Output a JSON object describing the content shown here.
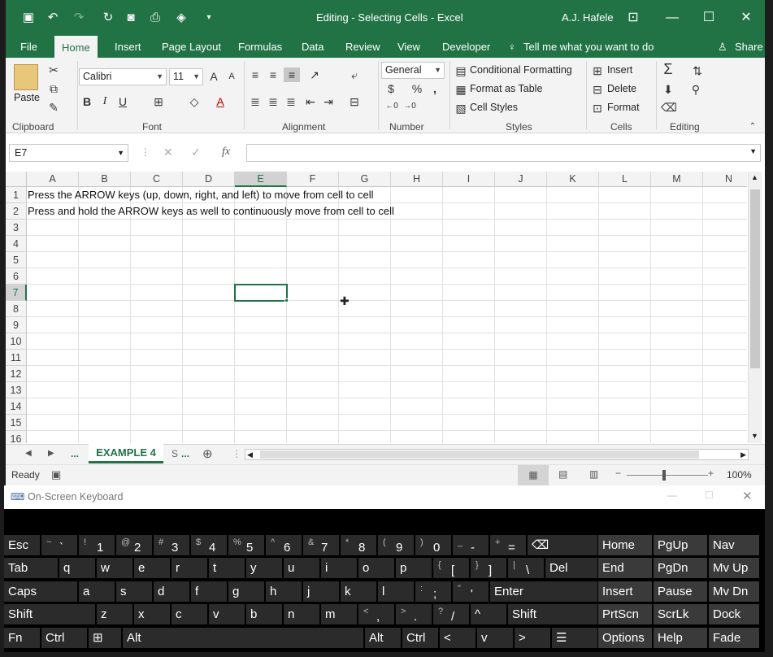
{
  "window": {
    "title": "Editing - Selecting Cells  -  Excel",
    "user": "A.J. Hafele"
  },
  "ribbon_tabs": [
    "File",
    "Home",
    "Insert",
    "Page Layout",
    "Formulas",
    "Data",
    "Review",
    "View",
    "Developer"
  ],
  "tell_me": "Tell me what you want to do",
  "share": "Share",
  "clipboard": {
    "paste": "Paste",
    "label": "Clipboard"
  },
  "font": {
    "name": "Calibri",
    "size": "11",
    "label": "Font",
    "bold": "B",
    "italic": "I",
    "underline": "U"
  },
  "alignment": {
    "label": "Alignment"
  },
  "number": {
    "format": "General",
    "label": "Number",
    "currency": "$",
    "percent": "%",
    "comma": ","
  },
  "styles": {
    "conditional": "Conditional Formatting",
    "table": "Format as Table",
    "cell": "Cell Styles",
    "label": "Styles"
  },
  "cells": {
    "insert": "Insert",
    "delete": "Delete",
    "format": "Format",
    "label": "Cells"
  },
  "editing": {
    "label": "Editing"
  },
  "formula_bar": {
    "name_box": "E7",
    "fx": "fx",
    "value": ""
  },
  "columns": [
    "A",
    "B",
    "C",
    "D",
    "E",
    "F",
    "G",
    "H",
    "I",
    "J",
    "K",
    "L",
    "M",
    "N"
  ],
  "rows": [
    "1",
    "2",
    "3",
    "4",
    "5",
    "6",
    "7",
    "8",
    "9",
    "10",
    "11",
    "12",
    "13",
    "14",
    "15",
    "16"
  ],
  "cells_data": {
    "a1": "Press the ARROW keys (up, down, right, and left) to move from cell to cell",
    "a2": "Press and hold the ARROW keys as well to continuously move from cell to cell"
  },
  "sheets": {
    "more_left": "...",
    "active": "EXAMPLE 4",
    "more_right": "...",
    "partial": "S"
  },
  "status": {
    "mode": "Ready",
    "zoom": "100%"
  },
  "osk": {
    "title": "On-Screen Keyboard",
    "rows": [
      [
        {
          "m": "Esc"
        },
        {
          "s": "~",
          "m": "`"
        },
        {
          "s": "!",
          "m": "1"
        },
        {
          "s": "@",
          "m": "2"
        },
        {
          "s": "#",
          "m": "3"
        },
        {
          "s": "$",
          "m": "4"
        },
        {
          "s": "%",
          "m": "5"
        },
        {
          "s": "^",
          "m": "6"
        },
        {
          "s": "&",
          "m": "7"
        },
        {
          "s": "*",
          "m": "8"
        },
        {
          "s": "(",
          "m": "9"
        },
        {
          "s": ")",
          "m": "0"
        },
        {
          "s": "_",
          "m": "-"
        },
        {
          "s": "+",
          "m": "="
        },
        {
          "m": "⌫"
        }
      ],
      [
        {
          "m": "Tab"
        },
        {
          "m": "q"
        },
        {
          "m": "w"
        },
        {
          "m": "e"
        },
        {
          "m": "r"
        },
        {
          "m": "t"
        },
        {
          "m": "y"
        },
        {
          "m": "u"
        },
        {
          "m": "i"
        },
        {
          "m": "o"
        },
        {
          "m": "p"
        },
        {
          "s": "{",
          "m": "["
        },
        {
          "s": "}",
          "m": "]"
        },
        {
          "s": "|",
          "m": "\\"
        },
        {
          "m": "Del"
        }
      ],
      [
        {
          "m": "Caps"
        },
        {
          "m": "a"
        },
        {
          "m": "s"
        },
        {
          "m": "d"
        },
        {
          "m": "f"
        },
        {
          "m": "g"
        },
        {
          "m": "h"
        },
        {
          "m": "j"
        },
        {
          "m": "k"
        },
        {
          "m": "l"
        },
        {
          "s": ":",
          "m": ";"
        },
        {
          "s": "\"",
          "m": "'"
        },
        {
          "m": "Enter"
        }
      ],
      [
        {
          "m": "Shift"
        },
        {
          "m": "z"
        },
        {
          "m": "x"
        },
        {
          "m": "c"
        },
        {
          "m": "v"
        },
        {
          "m": "b"
        },
        {
          "m": "n"
        },
        {
          "m": "m"
        },
        {
          "s": "<",
          "m": ","
        },
        {
          "s": ">",
          "m": "."
        },
        {
          "s": "?",
          "m": "/"
        },
        {
          "m": "^"
        },
        {
          "m": "Shift"
        }
      ],
      [
        {
          "m": "Fn"
        },
        {
          "m": "Ctrl"
        },
        {
          "m": "⊞"
        },
        {
          "m": "Alt"
        },
        {
          "m": ""
        },
        {
          "m": "Alt"
        },
        {
          "m": "Ctrl"
        },
        {
          "m": "<"
        },
        {
          "m": "v"
        },
        {
          "m": ">"
        },
        {
          "m": "☰"
        }
      ]
    ],
    "nav": [
      [
        "Home",
        "PgUp",
        "Nav"
      ],
      [
        "End",
        "PgDn",
        "Mv Up"
      ],
      [
        "Insert",
        "Pause",
        "Mv Dn"
      ],
      [
        "PrtScn",
        "ScrLk",
        "Dock"
      ],
      [
        "Options",
        "Help",
        "Fade"
      ]
    ]
  }
}
